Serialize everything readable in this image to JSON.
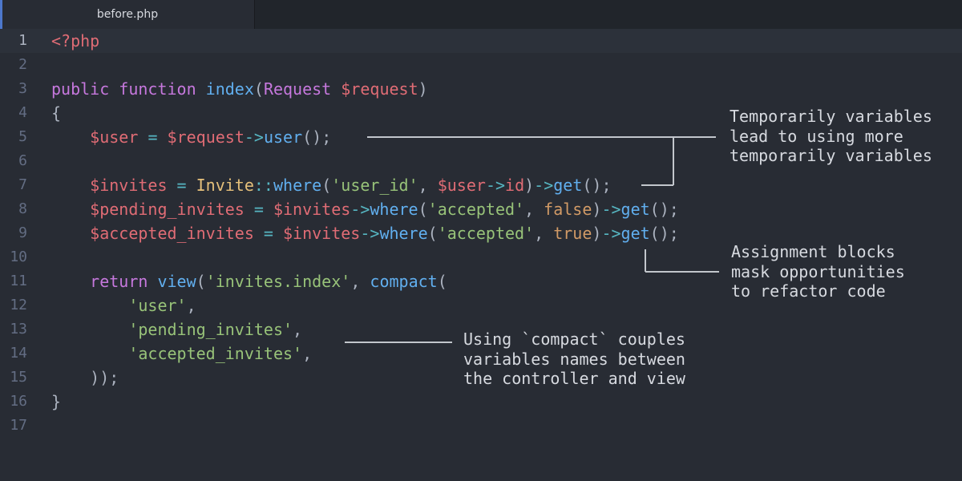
{
  "tab": {
    "title": "before.php"
  },
  "colors": {
    "background": "#282c34",
    "tabbar": "#21252b",
    "accent": "#4d78cc",
    "keyword": "#c678dd",
    "function": "#61afef",
    "variable": "#e06c75",
    "string": "#98c379",
    "class": "#e5c07b",
    "number_bool": "#d19a66",
    "operator": "#56b6c2"
  },
  "editor": {
    "line_numbers": [
      "1",
      "2",
      "3",
      "4",
      "5",
      "6",
      "7",
      "8",
      "9",
      "10",
      "11",
      "12",
      "13",
      "14",
      "15",
      "16",
      "17"
    ],
    "active_line": "1",
    "code": {
      "l1": [
        "<?php"
      ],
      "l3": [
        "public",
        " ",
        "function",
        " ",
        "index",
        "(",
        "Request",
        " ",
        "$request",
        ")"
      ],
      "l4": [
        "{"
      ],
      "l5": [
        "    ",
        "$user",
        " ",
        "=",
        " ",
        "$request",
        "->",
        "user",
        "();"
      ],
      "l7": [
        "    ",
        "$invites",
        " ",
        "=",
        " ",
        "Invite",
        "::",
        "where",
        "(",
        "'user_id'",
        ", ",
        "$user",
        "->",
        "id",
        ")",
        "->",
        "get",
        "();"
      ],
      "l8": [
        "    ",
        "$pending_invites",
        " ",
        "=",
        " ",
        "$invites",
        "->",
        "where",
        "(",
        "'accepted'",
        ", ",
        "false",
        ")",
        "->",
        "get",
        "();"
      ],
      "l9": [
        "    ",
        "$accepted_invites",
        " ",
        "=",
        " ",
        "$invites",
        "->",
        "where",
        "(",
        "'accepted'",
        ", ",
        "true",
        ")",
        "->",
        "get",
        "();"
      ],
      "l11": [
        "    ",
        "return",
        " ",
        "view",
        "(",
        "'invites.index'",
        ", ",
        "compact",
        "("
      ],
      "l12": [
        "        ",
        "'user'",
        ","
      ],
      "l13": [
        "        ",
        "'pending_invites'",
        ","
      ],
      "l14": [
        "        ",
        "'accepted_invites'",
        ","
      ],
      "l15": [
        "    ",
        "));"
      ],
      "l16": [
        "}"
      ]
    }
  },
  "annotations": {
    "temporary_variables": "Temporarily variables\nlead to using more\ntemporarily variables",
    "assignment_blocks": "Assignment blocks\nmask opportunities\nto refactor code",
    "compact": "Using `compact` couples\nvariables names between\nthe controller and view"
  }
}
